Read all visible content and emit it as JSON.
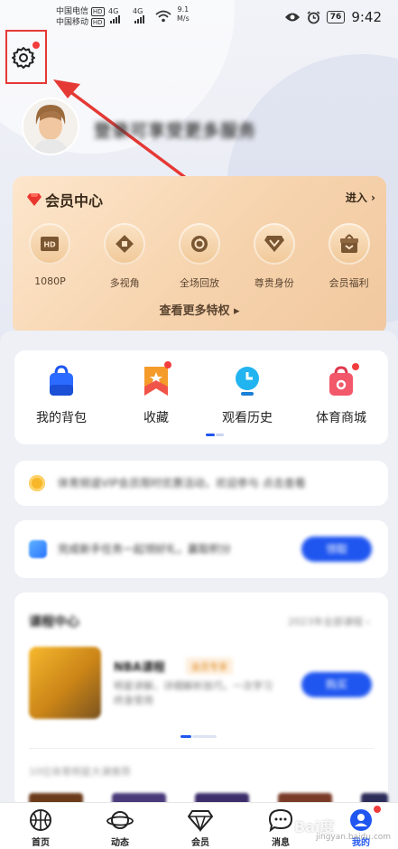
{
  "status_bar": {
    "carrier1": "中国电信",
    "carrier2": "中国移动",
    "hd": "HD",
    "net1": "4G",
    "net2": "4G",
    "speed_value": "9.1",
    "speed_unit": "M/s",
    "battery": "76",
    "time": "9:42"
  },
  "profile": {
    "username": "登录可享受更多服务"
  },
  "member": {
    "title": "会员中心",
    "enter": "进入 ›",
    "more": "查看更多特权 ▸",
    "perks": [
      {
        "label": "1080P",
        "icon": "hd-icon"
      },
      {
        "label": "多视角",
        "icon": "multi-view-icon"
      },
      {
        "label": "全场回放",
        "icon": "replay-icon"
      },
      {
        "label": "尊贵身份",
        "icon": "vip-identity-icon"
      },
      {
        "label": "会员福利",
        "icon": "gift-icon"
      }
    ]
  },
  "quick": [
    {
      "label": "我的背包",
      "icon": "backpack-icon",
      "dot": false
    },
    {
      "label": "收藏",
      "icon": "favorite-icon",
      "dot": true
    },
    {
      "label": "观看历史",
      "icon": "history-icon",
      "dot": false
    },
    {
      "label": "体育商城",
      "icon": "shop-icon",
      "dot": true
    }
  ],
  "notice": {
    "text": "体育频道VIP会员限时优惠活动，欢迎参与 点击查看"
  },
  "task": {
    "text": "完成新手任务一起领好礼，赢取积分",
    "button": "领取"
  },
  "course": {
    "title": "课程中心",
    "subtitle": "2023年全部课程 ›",
    "name": "NBA课程",
    "tag": "会员专享",
    "desc": "明星讲解，详细解析技巧，一次学习终身受用",
    "button": "购买",
    "more": "10位体育明星大课推荐"
  },
  "tabs": [
    {
      "label": "首页",
      "icon": "basketball-icon",
      "active": false
    },
    {
      "label": "动态",
      "icon": "planet-icon",
      "active": false
    },
    {
      "label": "会员",
      "icon": "diamond-icon",
      "active": false
    },
    {
      "label": "消息",
      "icon": "message-icon",
      "active": false
    },
    {
      "label": "我的",
      "icon": "profile-icon",
      "active": true
    }
  ],
  "watermark": {
    "main": "Bai度",
    "sub": "jingyan.baidu.com"
  },
  "colors": {
    "accent": "#1f56f0",
    "annotation_red": "#e53935",
    "badge_red": "#f23d3d",
    "member_text": "#5a4430"
  }
}
